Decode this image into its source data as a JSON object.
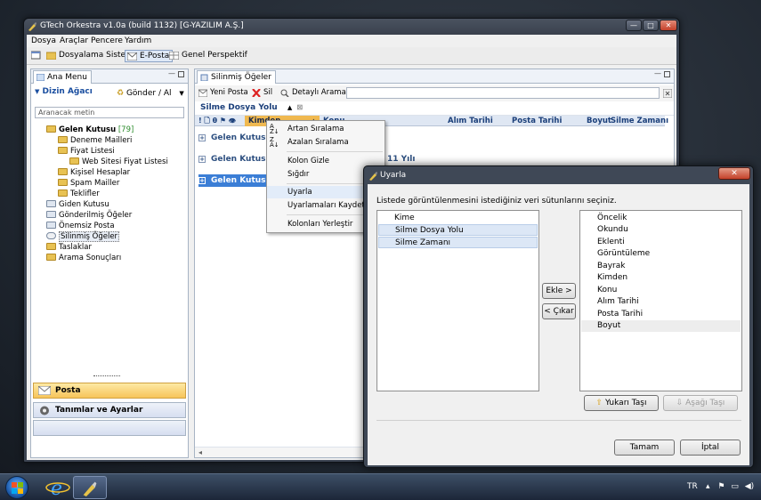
{
  "window": {
    "title": "GTech Orkestra v1.0a (build 1132) [G-YAZILIM A.Ş.]",
    "minimize": "—",
    "maximize": "□",
    "close": "✕"
  },
  "menubar": [
    "Dosya",
    "Araçlar",
    "Pencere",
    "Yardım"
  ],
  "perspectives": [
    {
      "label": "Dosyalama Sistemi",
      "active": false
    },
    {
      "label": "E-Posta",
      "active": true
    },
    {
      "label": "Genel Perspektif",
      "active": false
    }
  ],
  "left_panel": {
    "tab": "Ana Menu",
    "tree_header": "Dizin Ağacı",
    "send_receive": "Gönder / Al",
    "search_placeholder": "Aranacak metin",
    "tree": [
      {
        "label": "Gelen Kutusu",
        "count": "[79]",
        "bold": true,
        "indent": 0
      },
      {
        "label": "Deneme Mailleri",
        "indent": 1
      },
      {
        "label": "Fiyat Listesi",
        "indent": 1
      },
      {
        "label": "Web Sitesi Fiyat Listesi",
        "indent": 2
      },
      {
        "label": "Kişisel Hesaplar",
        "indent": 1
      },
      {
        "label": "Spam Mailler",
        "indent": 1
      },
      {
        "label": "Teklifler",
        "indent": 1
      },
      {
        "label": "Giden Kutusu",
        "indent": 0
      },
      {
        "label": "Gönderilmiş Öğeler",
        "indent": 0
      },
      {
        "label": "Önemsiz Posta",
        "indent": 0
      },
      {
        "label": "Silinmiş Öğeler",
        "indent": 0
      },
      {
        "label": "Taslaklar",
        "indent": 0
      },
      {
        "label": "Arama Sonuçları",
        "indent": 0
      }
    ],
    "nav_post": "Posta",
    "nav_settings": "Tanımlar ve Ayarlar"
  },
  "right_panel": {
    "tab": "Silinmiş Öğeler",
    "toolbar": {
      "new_mail": "Yeni Posta",
      "delete": "Sil",
      "advanced_search": "Detaylı Arama"
    },
    "group_by": "Silme Dosya Yolu",
    "columns": [
      "Kimden",
      "Konu",
      "Alım Tarihi",
      "Posta Tarihi",
      "Boyut",
      "Silme Zamanı"
    ],
    "groups": [
      {
        "label": "Gelen Kutusu/Ki",
        "selected": false
      },
      {
        "label": "Gelen Kutusu/Ki",
        "selected": false
      },
      {
        "label": "Gelen Kutusu/Şir",
        "selected": true
      }
    ],
    "partial_subject": "11 Yılı"
  },
  "context_menu": [
    {
      "label": "Artan Sıralama",
      "icon": "sort-ascending-icon"
    },
    {
      "label": "Azalan Sıralama",
      "icon": "sort-descending-icon"
    },
    {
      "label": "Kolon Gizle"
    },
    {
      "label": "Sığdır"
    },
    {
      "label": "Uyarla",
      "highlight": true
    },
    {
      "label": "Uyarlamaları Kaydet"
    },
    {
      "label": "Kolonları Yerleştir"
    }
  ],
  "dialog": {
    "title": "Uyarla",
    "close": "✕",
    "description": "Listede görüntülenmesini istediğiniz veri sütunlarını seçiniz.",
    "left_list": [
      {
        "label": "Kime",
        "selected": false
      },
      {
        "label": "Silme Dosya Yolu",
        "selected": true
      },
      {
        "label": "Silme Zamanı",
        "selected": true
      }
    ],
    "right_list": [
      {
        "label": "Öncelik"
      },
      {
        "label": "Okundu"
      },
      {
        "label": "Eklenti"
      },
      {
        "label": "Görüntüleme"
      },
      {
        "label": "Bayrak"
      },
      {
        "label": "Kimden"
      },
      {
        "label": "Konu"
      },
      {
        "label": "Alım Tarihi"
      },
      {
        "label": "Posta Tarihi"
      },
      {
        "label": "Boyut",
        "alt": true
      }
    ],
    "add_button": "Ekle >",
    "remove_button": "< Çıkar",
    "move_up": "Yukarı Taşı",
    "move_down": "Aşağı Taşı",
    "ok": "Tamam",
    "cancel": "İptal"
  },
  "taskbar": {
    "language": "TR"
  }
}
